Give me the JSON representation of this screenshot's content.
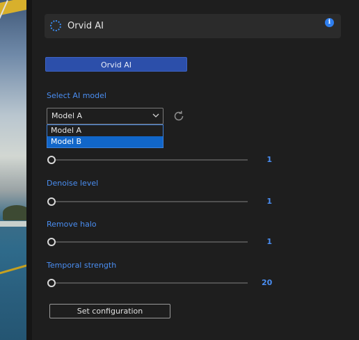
{
  "header": {
    "title": "Orvid AI",
    "icon": "spinner-icon",
    "info_icon": "info-icon",
    "info_glyph": "i"
  },
  "main_button": {
    "label": "Orvid AI"
  },
  "model": {
    "label": "Select AI model",
    "selected": "Model A",
    "options": [
      "Model A",
      "Model B"
    ],
    "highlighted_option": "Model B"
  },
  "sliders": [
    {
      "label": "",
      "value": "1",
      "fraction": 0.0
    },
    {
      "label": "Denoise level",
      "value": "1",
      "fraction": 0.0
    },
    {
      "label": "Remove halo",
      "value": "1",
      "fraction": 0.0
    },
    {
      "label": "Temporal strength",
      "value": "20",
      "fraction": 0.0
    }
  ],
  "set_config": {
    "label": "Set configuration"
  },
  "colors": {
    "accent": "#4a8ef2",
    "button_blue": "#2c4faa",
    "highlight": "#1166c9",
    "background": "#1e1e1e"
  }
}
